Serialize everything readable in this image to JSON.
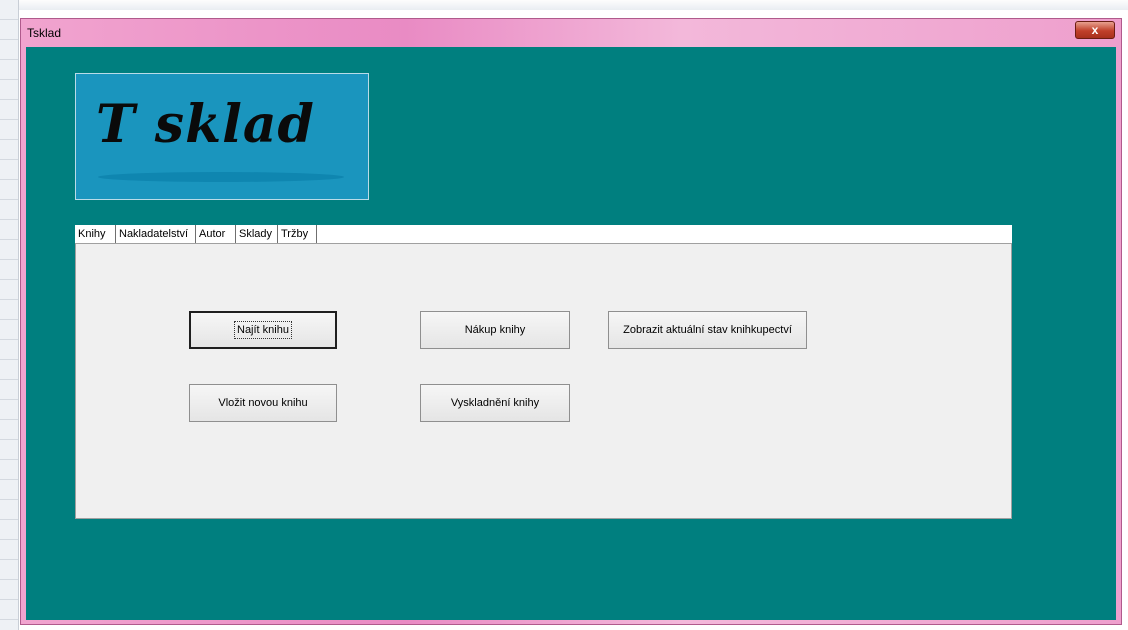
{
  "window": {
    "title": "Tsklad",
    "close_label": "x"
  },
  "logo": {
    "text": "T sklad"
  },
  "tabs": [
    {
      "label": "Knihy",
      "active": true
    },
    {
      "label": "Nakladatelství",
      "active": false
    },
    {
      "label": "Autor",
      "active": false
    },
    {
      "label": "Sklady",
      "active": false
    },
    {
      "label": "Tržby",
      "active": false
    }
  ],
  "buttons": {
    "find_book": "Najít knihu",
    "buy_book": "Nákup knihy",
    "show_status": "Zobrazit aktuální stav knihkupectví",
    "insert_book": "Vložit novou knihu",
    "dispatch_book": "Vyskladnění knihy"
  },
  "colors": {
    "client_background": "#007f7f",
    "logo_background": "#1a95be",
    "titlebar_gradient": "#e98bc4",
    "panel_background": "#f0f0f0"
  }
}
